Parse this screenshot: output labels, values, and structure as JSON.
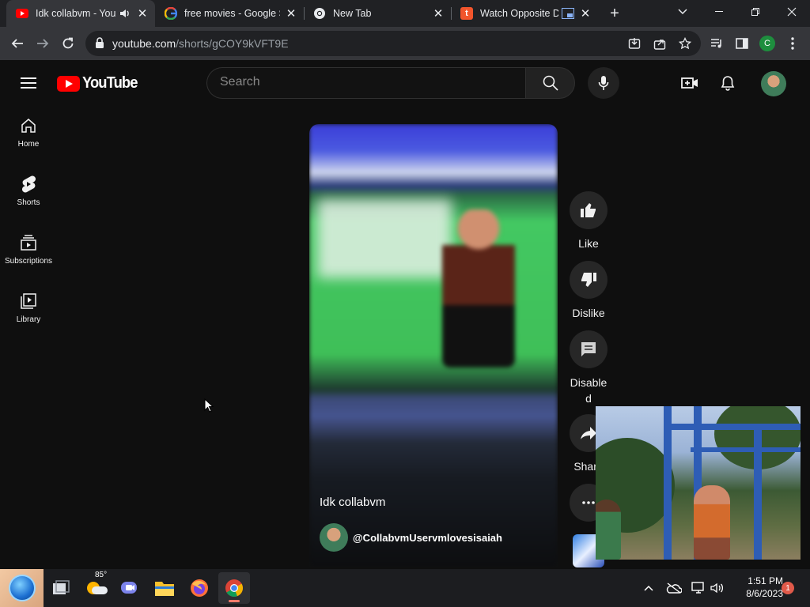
{
  "browser": {
    "tabs": [
      {
        "title": "Idk collabvm - You",
        "favicon": "youtube-favicon",
        "active": true
      },
      {
        "title": "free movies - Google S",
        "favicon": "google-favicon",
        "active": false
      },
      {
        "title": "New Tab",
        "favicon": "chrome-favicon",
        "active": false
      },
      {
        "title": "Watch Opposite Da",
        "favicon": "tubi-favicon",
        "active": false
      }
    ],
    "new_tab_label": "+",
    "address": {
      "host": "youtube.com",
      "path": "/shorts/gCOY9kVFT9E"
    },
    "profile_initial": "C"
  },
  "youtube": {
    "logo_text": "YouTube",
    "search": {
      "placeholder": "Search"
    },
    "sidebar": [
      {
        "label": "Home",
        "icon": "home-icon"
      },
      {
        "label": "Shorts",
        "icon": "shorts-icon"
      },
      {
        "label": "Subscriptions",
        "icon": "subscriptions-icon"
      },
      {
        "label": "Library",
        "icon": "library-icon"
      }
    ],
    "short": {
      "title": "Idk collabvm",
      "channel": "@CollabvmUservmlovesisaiah"
    },
    "actions": [
      {
        "label": "Like",
        "icon": "thumbs-up-icon"
      },
      {
        "label": "Dislike",
        "icon": "thumbs-down-icon"
      },
      {
        "label": "Disable\nd",
        "icon": "comments-icon"
      },
      {
        "label": "Share",
        "icon": "share-icon"
      },
      {
        "label": "",
        "icon": "more-icon"
      }
    ]
  },
  "taskbar": {
    "weather_temp": "85°",
    "time": "1:51 PM",
    "date": "8/6/2023",
    "notification_count": "1"
  },
  "colors": {
    "yt_bg": "#0f0f0f",
    "yt_red": "#ff0000",
    "chrome_frame": "#202124",
    "chrome_toolbar": "#35363a"
  }
}
